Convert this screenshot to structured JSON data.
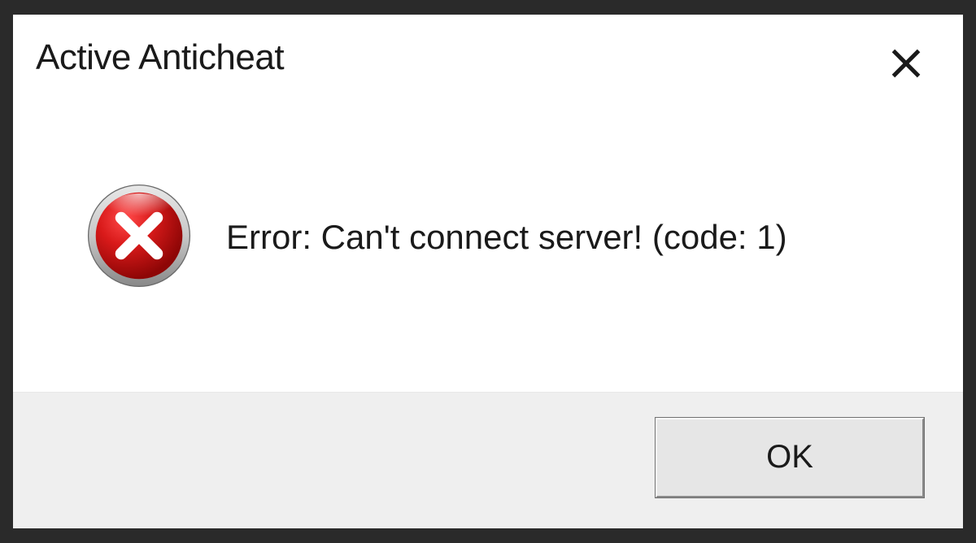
{
  "dialog": {
    "title": "Active Anticheat",
    "message": "Error: Can't connect server! (code: 1)",
    "ok_button_label": "OK"
  }
}
